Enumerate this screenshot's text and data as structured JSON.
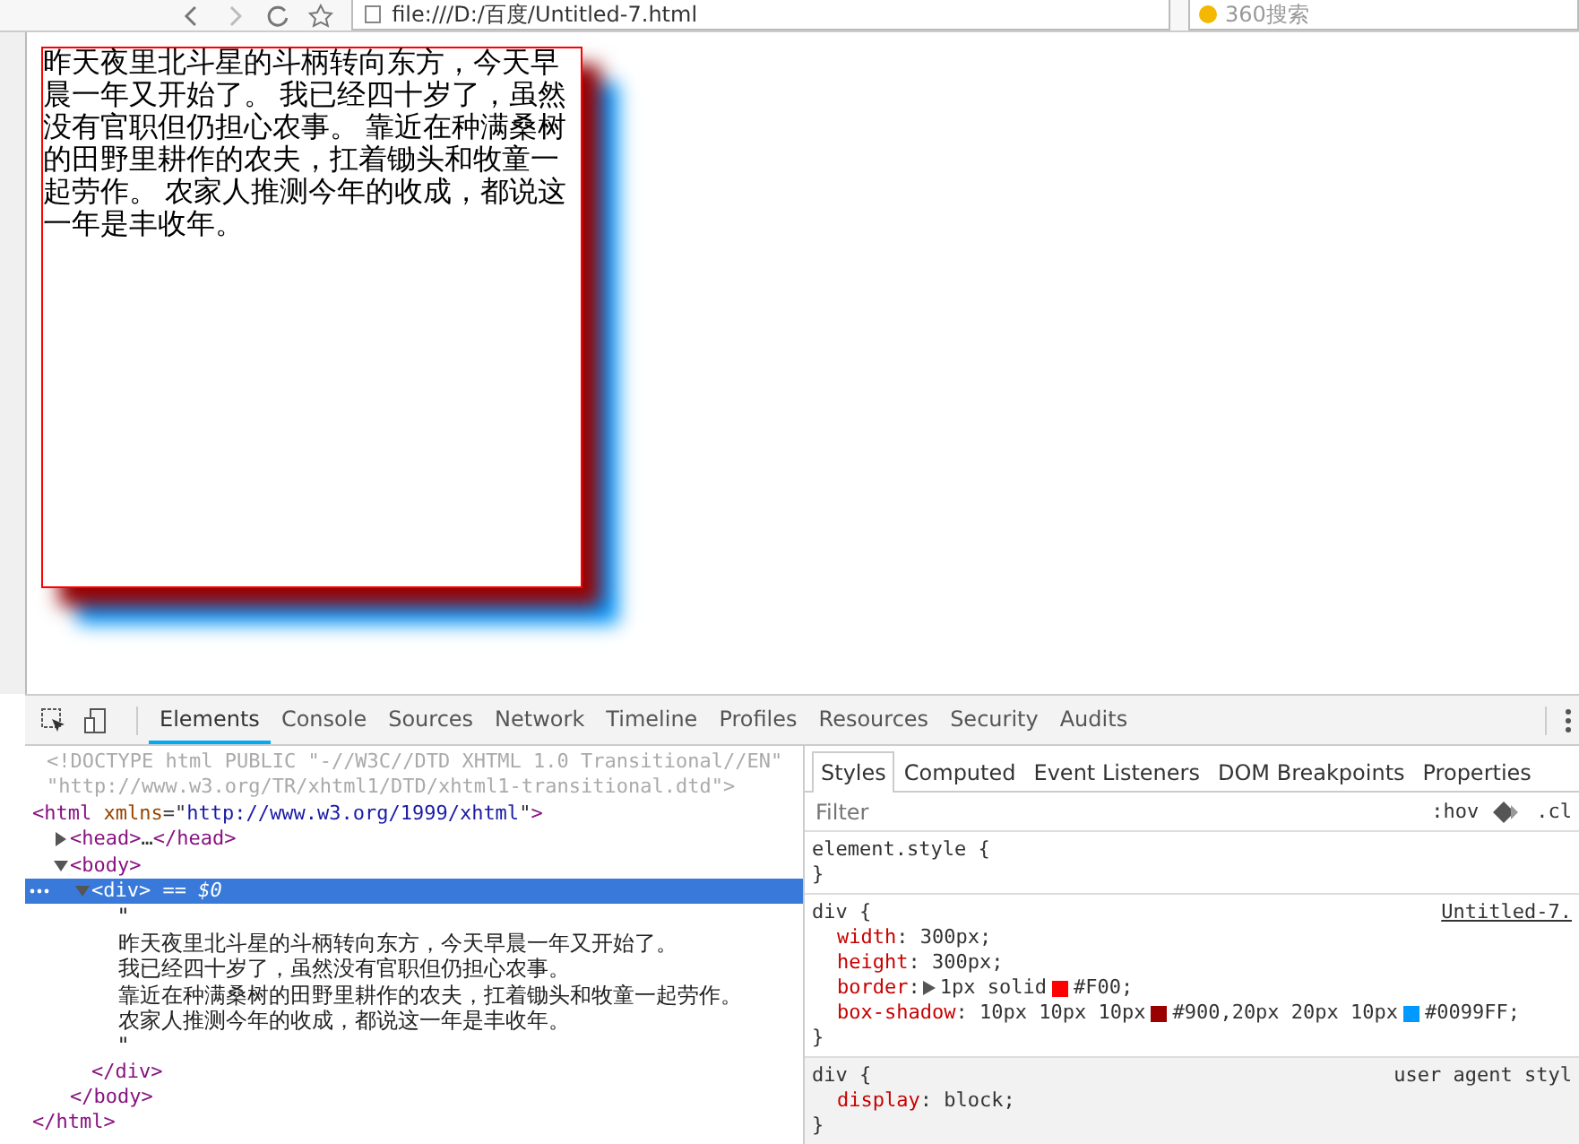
{
  "browser": {
    "url": "file:///D:/百度/Untitled-7.html",
    "search_placeholder": "360搜索"
  },
  "page": {
    "text": "昨天夜里北斗星的斗柄转向东方，今天早晨一年又开始了。 我已经四十岁了，虽然没有官职但仍担心农事。 靠近在种满桑树的田野里耕作的农夫，扛着锄头和牧童一起劳作。 农家人推测今年的收成，都说这一年是丰收年。"
  },
  "devtools": {
    "tabs": [
      {
        "label": "Elements",
        "selected": true
      },
      {
        "label": "Console",
        "selected": false
      },
      {
        "label": "Sources",
        "selected": false
      },
      {
        "label": "Network",
        "selected": false
      },
      {
        "label": "Timeline",
        "selected": false
      },
      {
        "label": "Profiles",
        "selected": false
      },
      {
        "label": "Resources",
        "selected": false
      },
      {
        "label": "Security",
        "selected": false
      },
      {
        "label": "Audits",
        "selected": false
      }
    ],
    "dom": [
      {
        "kind": "doctype",
        "lines": [
          "<!DOCTYPE html PUBLIC \"-//W3C//DTD XHTML 1.0 Transitional//EN\"",
          "\"http://www.w3.org/TR/xhtml1/DTD/xhtml1-transitional.dtd\">"
        ]
      },
      {
        "kind": "element",
        "selected": false,
        "segments": [
          {
            "kind": "tag",
            "text": "<html"
          },
          {
            "kind": "attr_name",
            "text": " xmlns"
          },
          {
            "kind": "punct",
            "text": "=\""
          },
          {
            "kind": "attr_value",
            "text": "http://www.w3.org/1999/xhtml"
          },
          {
            "kind": "punct",
            "text": "\""
          },
          {
            "kind": "tag",
            "text": ">"
          }
        ],
        "close_tag": "</html>",
        "children": [
          {
            "kind": "element",
            "expanded": false,
            "selected": false,
            "segments": [
              {
                "kind": "tag",
                "text": "<head>"
              },
              {
                "kind": "punct",
                "text": "…"
              },
              {
                "kind": "tag",
                "text": "</head>"
              }
            ]
          },
          {
            "kind": "element",
            "expanded": true,
            "selected": false,
            "segments": [
              {
                "kind": "tag",
                "text": "<body>"
              }
            ],
            "close_tag": "</body>",
            "children": [
              {
                "kind": "element",
                "expanded": true,
                "selected": true,
                "segments": [
                  {
                    "kind": "tag",
                    "text": "<div>"
                  },
                  {
                    "kind": "marker",
                    "text": " == $0"
                  }
                ],
                "close_tag": "</div>",
                "children": [
                  {
                    "kind": "text",
                    "lines": [
                      "\"",
                      "昨天夜里北斗星的斗柄转向东方，今天早晨一年又开始了。",
                      "我已经四十岁了，虽然没有官职但仍担心农事。",
                      "靠近在种满桑树的田野里耕作的农夫，扛着锄头和牧童一起劳作。",
                      "农家人推测今年的收成，都说这一年是丰收年。",
                      "\""
                    ]
                  }
                ]
              }
            ]
          }
        ]
      }
    ],
    "style_tabs": [
      {
        "label": "Styles",
        "selected": true
      },
      {
        "label": "Computed",
        "selected": false
      },
      {
        "label": "Event Listeners",
        "selected": false
      },
      {
        "label": "DOM Breakpoints",
        "selected": false
      },
      {
        "label": "Properties",
        "selected": false
      }
    ],
    "filter_placeholder": "Filter",
    "hov": ":hov",
    "cls": ".cl",
    "rules": [
      {
        "selector": "element.style {",
        "close": "}",
        "user_agent": false
      },
      {
        "selector": "div {",
        "source": "Untitled-7.",
        "close": "}",
        "user_agent": false,
        "declarations": [
          {
            "name": "width",
            "sep": ":",
            "segments": [
              {
                "text": "300px;"
              }
            ]
          },
          {
            "name": "height",
            "sep": ":",
            "segments": [
              {
                "text": "300px;"
              }
            ]
          },
          {
            "name": "border",
            "sep": ":",
            "expandable": true,
            "segments": [
              {
                "text": "1px solid"
              },
              {
                "text": "#F00;",
                "color": "#ff0000"
              }
            ]
          },
          {
            "name": "box-shadow",
            "sep": ":",
            "segments": [
              {
                "text": "10px 10px 10px"
              },
              {
                "text": "#900,20px 20px 10px",
                "color": "#990000"
              },
              {
                "text": "#0099FF;",
                "color": "#0099ff"
              }
            ]
          }
        ]
      },
      {
        "selector": "div {",
        "source": "user agent styl",
        "close": "}",
        "user_agent": true,
        "declarations": [
          {
            "name": "display",
            "sep": ":",
            "segments": [
              {
                "text": "block;"
              }
            ]
          }
        ]
      }
    ]
  }
}
